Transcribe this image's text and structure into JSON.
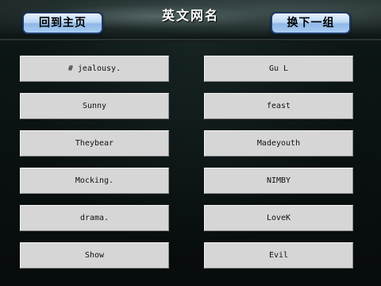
{
  "header": {
    "title": "英文网名",
    "home_button": "回到主页",
    "next_button": "换下一组"
  },
  "names": {
    "left": [
      "# jealousy.",
      "Sunny",
      "Theybear",
      "Mocking.",
      "drama.",
      "Show"
    ],
    "right": [
      "Gu L",
      "feast",
      "Madeyouth",
      "NIMBY",
      "LoveK",
      "Evil"
    ]
  }
}
